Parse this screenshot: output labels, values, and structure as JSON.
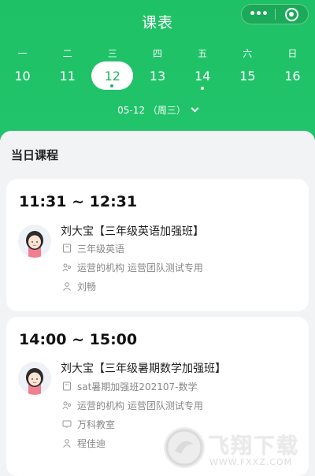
{
  "header": {
    "title": "课表",
    "capsule": {
      "more_label": "•••",
      "more_icon": "more-icon",
      "close_icon": "target-icon"
    }
  },
  "calendar": {
    "week": [
      {
        "weekday": "一",
        "date": "10",
        "selected": false,
        "has_class": false
      },
      {
        "weekday": "二",
        "date": "11",
        "selected": false,
        "has_class": false
      },
      {
        "weekday": "三",
        "date": "12",
        "selected": true,
        "has_class": true
      },
      {
        "weekday": "四",
        "date": "13",
        "selected": false,
        "has_class": false
      },
      {
        "weekday": "五",
        "date": "14",
        "selected": false,
        "has_class": true
      },
      {
        "weekday": "六",
        "date": "15",
        "selected": false,
        "has_class": false
      },
      {
        "weekday": "日",
        "date": "16",
        "selected": false,
        "has_class": false
      }
    ],
    "selected_date_label": "05-12 （周三）",
    "dropdown_icon": "chevron-down-icon"
  },
  "main": {
    "section_title": "当日课程",
    "courses": [
      {
        "time": "11:31 ~ 12:31",
        "title": "刘大宝【三年级英语加强班】",
        "subject": "三年级英语",
        "org": "运营的机构 运营团队测试专用",
        "teacher": "刘畅"
      },
      {
        "time": "14:00 ~ 15:00",
        "title": "刘大宝【三年级暑期数学加强班】",
        "subject": "sat暑期加强班202107-数学",
        "org": "运营的机构 运营团队测试专用",
        "classroom": "万科教室",
        "teacher": "程佳迪"
      }
    ]
  },
  "watermark": {
    "text": "飞翔下载",
    "url": "WWW.FXXZ.COM"
  },
  "colors": {
    "brand_green": "#1fc166",
    "selected_text": "#1fb763",
    "muted_text": "#888888"
  }
}
